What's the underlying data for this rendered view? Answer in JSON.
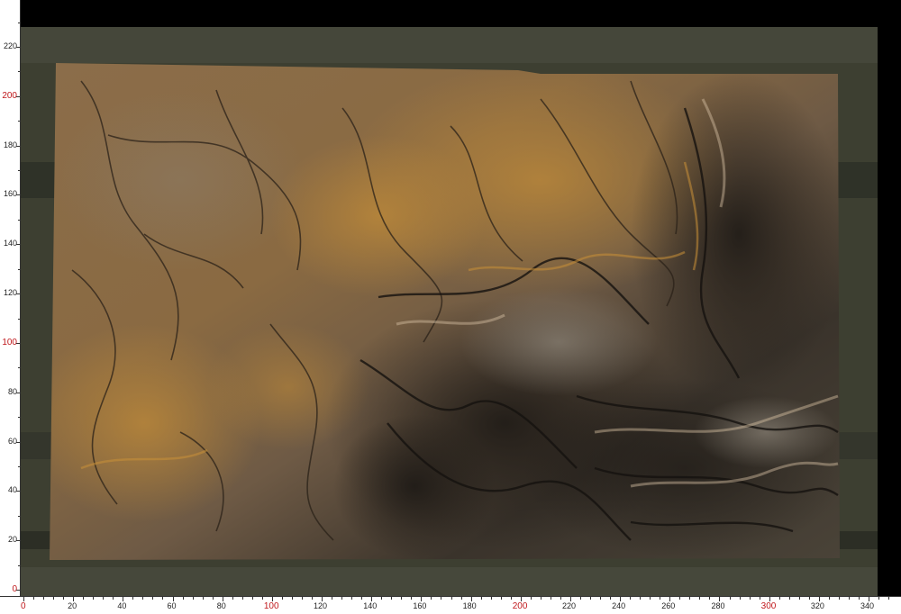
{
  "image": {
    "subject": "polished stone slab photo",
    "background_color": "#3d3f31",
    "frame_color": "#000000",
    "colors": {
      "slab_light": "#8a6a45",
      "slab_ochre": "#a8782f",
      "slab_dark": "#2b2620",
      "slab_gray": "#6f6a60"
    }
  },
  "ruler_left": {
    "labels": [
      "0",
      "20",
      "40",
      "60",
      "80",
      "100",
      "120",
      "140",
      "160",
      "180",
      "200",
      "220"
    ],
    "highlight": [
      "0",
      "100",
      "200"
    ],
    "highlight_color": "#c0181c"
  },
  "ruler_bottom": {
    "labels": [
      "0",
      "20",
      "40",
      "60",
      "80",
      "100",
      "120",
      "140",
      "160",
      "180",
      "200",
      "220",
      "240",
      "260",
      "280",
      "300",
      "320",
      "340"
    ],
    "highlight": [
      "0",
      "100",
      "200",
      "300"
    ],
    "highlight_color": "#c0181c"
  }
}
